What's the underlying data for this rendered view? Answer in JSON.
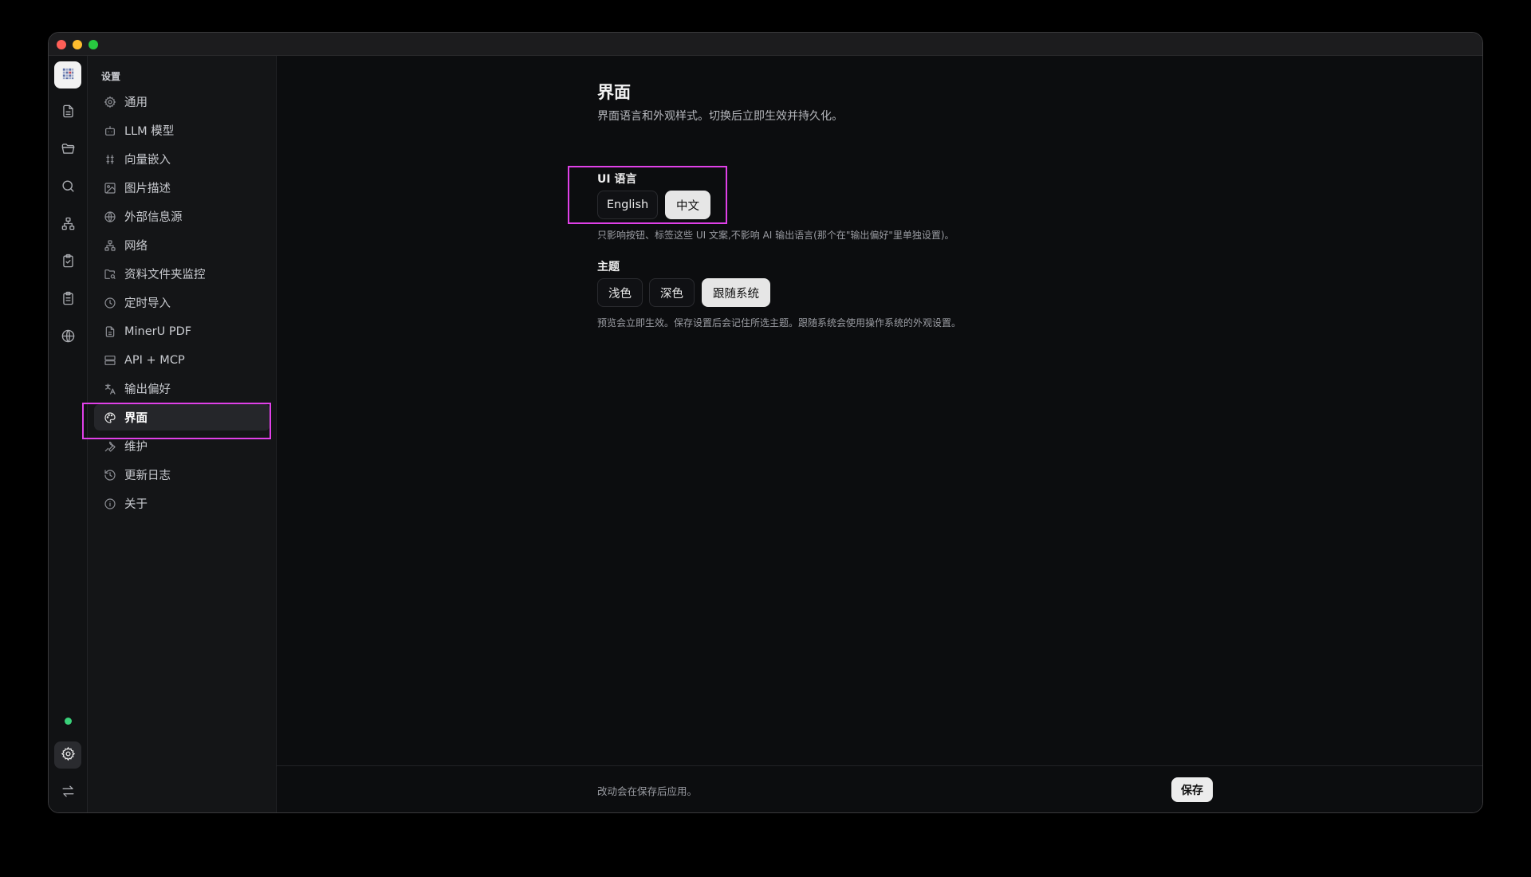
{
  "rail": {
    "icons": [
      "logo-icon",
      "document-icon",
      "folder-icon",
      "search-icon",
      "graph-icon",
      "clipboard-check-icon",
      "clipboard-list-icon",
      "globe-icon"
    ],
    "bottom_icons": [
      "settings-icon",
      "switch-icon"
    ],
    "status_color": "#3ad17a"
  },
  "sidebar": {
    "heading": "设置",
    "items": [
      {
        "label": "通用",
        "icon": "gear-icon"
      },
      {
        "label": "LLM 模型",
        "icon": "bot-icon"
      },
      {
        "label": "向量嵌入",
        "icon": "vector-icon"
      },
      {
        "label": "图片描述",
        "icon": "image-icon"
      },
      {
        "label": "外部信息源",
        "icon": "globe-icon"
      },
      {
        "label": "网络",
        "icon": "network-icon"
      },
      {
        "label": "资料文件夹监控",
        "icon": "folder-search-icon"
      },
      {
        "label": "定时导入",
        "icon": "clock-icon"
      },
      {
        "label": "MinerU PDF",
        "icon": "file-icon"
      },
      {
        "label": "API + MCP",
        "icon": "server-icon"
      },
      {
        "label": "输出偏好",
        "icon": "translate-icon"
      },
      {
        "label": "界面",
        "icon": "palette-icon",
        "active": true
      },
      {
        "label": "维护",
        "icon": "wrench-icon"
      },
      {
        "label": "更新日志",
        "icon": "history-icon"
      },
      {
        "label": "关于",
        "icon": "info-icon"
      }
    ]
  },
  "main": {
    "title": "界面",
    "description": "界面语言和外观样式。切换后立即生效并持久化。",
    "language": {
      "label": "UI 语言",
      "options": [
        "English",
        "中文"
      ],
      "selected": "中文",
      "hint": "只影响按钮、标签这些 UI 文案,不影响 AI 输出语言(那个在\"输出偏好\"里单独设置)。"
    },
    "theme": {
      "label": "主题",
      "options": [
        "浅色",
        "深色",
        "跟随系统"
      ],
      "selected": "跟随系统",
      "hint": "预览会立即生效。保存设置后会记住所选主题。跟随系统会使用操作系统的外观设置。"
    }
  },
  "footer": {
    "text": "改动会在保存后应用。",
    "save_label": "保存"
  },
  "colors": {
    "highlight": "#e040e8",
    "accent_selected": "#e6e6e6"
  }
}
